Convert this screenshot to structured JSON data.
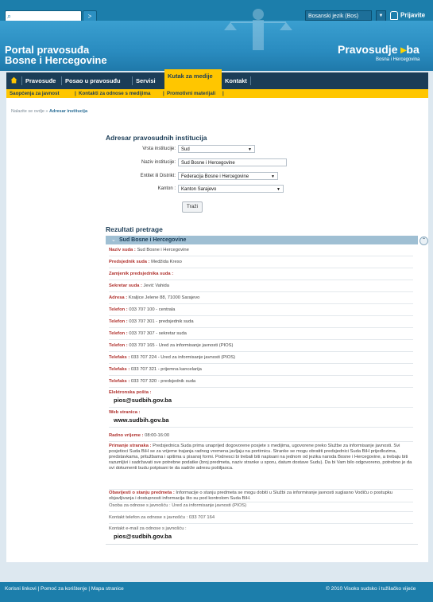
{
  "header": {
    "search_placeholder": "",
    "search_go": ">",
    "language": "Bosanski jezik (Bos)",
    "login": "Prijavite se",
    "portal_title_line1": "Portal pravosuđa",
    "portal_title_line2": "Bosne i Hercegovine",
    "logo_main": "Pravosudje",
    "logo_arrow": "▸",
    "logo_ba": "ba",
    "logo_sub": "Bosna i Hercegovina"
  },
  "nav": {
    "items": [
      "Pravosuđe",
      "Posao u pravosuđu",
      "Servisi",
      "Kutak za medije",
      "Kontakt"
    ],
    "active": "Kutak za medije"
  },
  "subnav": {
    "items": [
      "Saopćenja za javnost",
      "Kontakti za odnose s medijima",
      "Promotivni materijali"
    ]
  },
  "breadcrumb": {
    "prefix": "Nalazite se ovdje »",
    "current": "Adresar institucija"
  },
  "form": {
    "title": "Adresar pravosudnih institucija",
    "vrsta_label": "Vrsta institucije:",
    "vrsta_value": "Sud",
    "naziv_label": "Naziv institucije:",
    "naziv_value": "Sud Bosne i Hercegovine",
    "entitet_label": "Entitet ili Distrikt:",
    "entitet_value": "Federacija Bosne i Hercegovine",
    "kanton_label": "Kanton :",
    "kanton_value": "Kanton Sarajevo",
    "search_button": "Traži"
  },
  "results": {
    "title": "Rezultati pretrage",
    "header": "Sud Bosne i Hercegovine",
    "rows": [
      {
        "label": "Naziv suda :",
        "value": " Sud Bosne i Hercegovine"
      },
      {
        "label": "Predsjednik suda :",
        "value": " Medžida Kreso"
      },
      {
        "label": "Zamjenik predsjednika suda :",
        "value": ""
      },
      {
        "label": "Sekretar suda :",
        "value": " Jević Vahida"
      },
      {
        "label": "Adresa :",
        "value": " Kraljice Jelene 88, 71000 Sarajevo"
      },
      {
        "label": "Telefon :",
        "value": " 033 707 100 - centrala"
      },
      {
        "label": "Telefon :",
        "value": " 033 707 301 - predsjednik suda"
      },
      {
        "label": "Telefon :",
        "value": " 033 707 307 - sekretar suda"
      },
      {
        "label": "Telefon :",
        "value": " 033 707 165 - Ured za informisanje javnosti (PIOS)"
      },
      {
        "label": "Telefaks :",
        "value": " 033 707 224 - Ured za informisanje javnosti (PIOS)"
      },
      {
        "label": "Telefaks :",
        "value": " 033 707 321 - prijemna kancelarija"
      },
      {
        "label": "Telefaks :",
        "value": " 033 707 320 - predsjednik suda"
      }
    ],
    "email_label": "Elektronska pošta :",
    "email_value": "pios@sudbih.gov.ba",
    "web_label": "Web stranica :",
    "web_value": "www.sudbih.gov.ba",
    "hours_label": "Radno vrijeme :",
    "hours_value": " 08:00-16:00",
    "primanje_label": "Primanje stranaka :",
    "primanje_text": " Predsjednica Suda prima unaprijed dogovorene posjete s medijima, ugovorene preko Službe za informisanje javnosti. Svi posjetioci Suda BiH se za vrijeme trajanja radnog vremena javljaju na portirnicu. Stranke se mogu obratiti predsjednici Suda BiH prijedlozima, predstavkama, pritužbama i upitima u pisanoj formi. Podnesci bi trebali biti napisani na jednom od jezika naroda Bosne i Hercegovine, a trebaju biti razumljivi i sadržavati sve potrebne podatke (broj predmeta, naziv stranke u sporu, datum dostave Sudu). Da bi Vam bilo odgovoreno, potrebno je da svi dokumenti budu potpisani te da sadrže adresu pošiljaoca.",
    "obavijesti_label": "Obavijesti o stanju predmeta :",
    "obavijesti_text": " Informacije o stanju predmeta se mogu dobiti u Službi za informiranje javnosti suglasno Vodiču o postupku objavljivanja i dostupnosti informacija što su pod kontrolom Suda BiH.",
    "osoba_text": "Osoba za odnose s javnošću : Ured za informisanje javnosti (PIOS)",
    "kontakt_tel_text": "Kontakt telefon za odnose s javnošću : 033 707 164",
    "kontakt_email_label": "Kontakt e-mail za odnose s javnošću :",
    "kontakt_email_value": "pios@sudbih.gov.ba"
  },
  "footer": {
    "links": "Korisni linkovi | Pomoć za korištenje | Mapa stranice",
    "copyright": "© 2010 Visoko sudsko i tužilačko vijeće"
  },
  "colors": {
    "header_blue": "#1c7eab",
    "nav_dark": "#1b3d57",
    "accent_yellow": "#ffc600",
    "label_red": "#b0322e"
  }
}
